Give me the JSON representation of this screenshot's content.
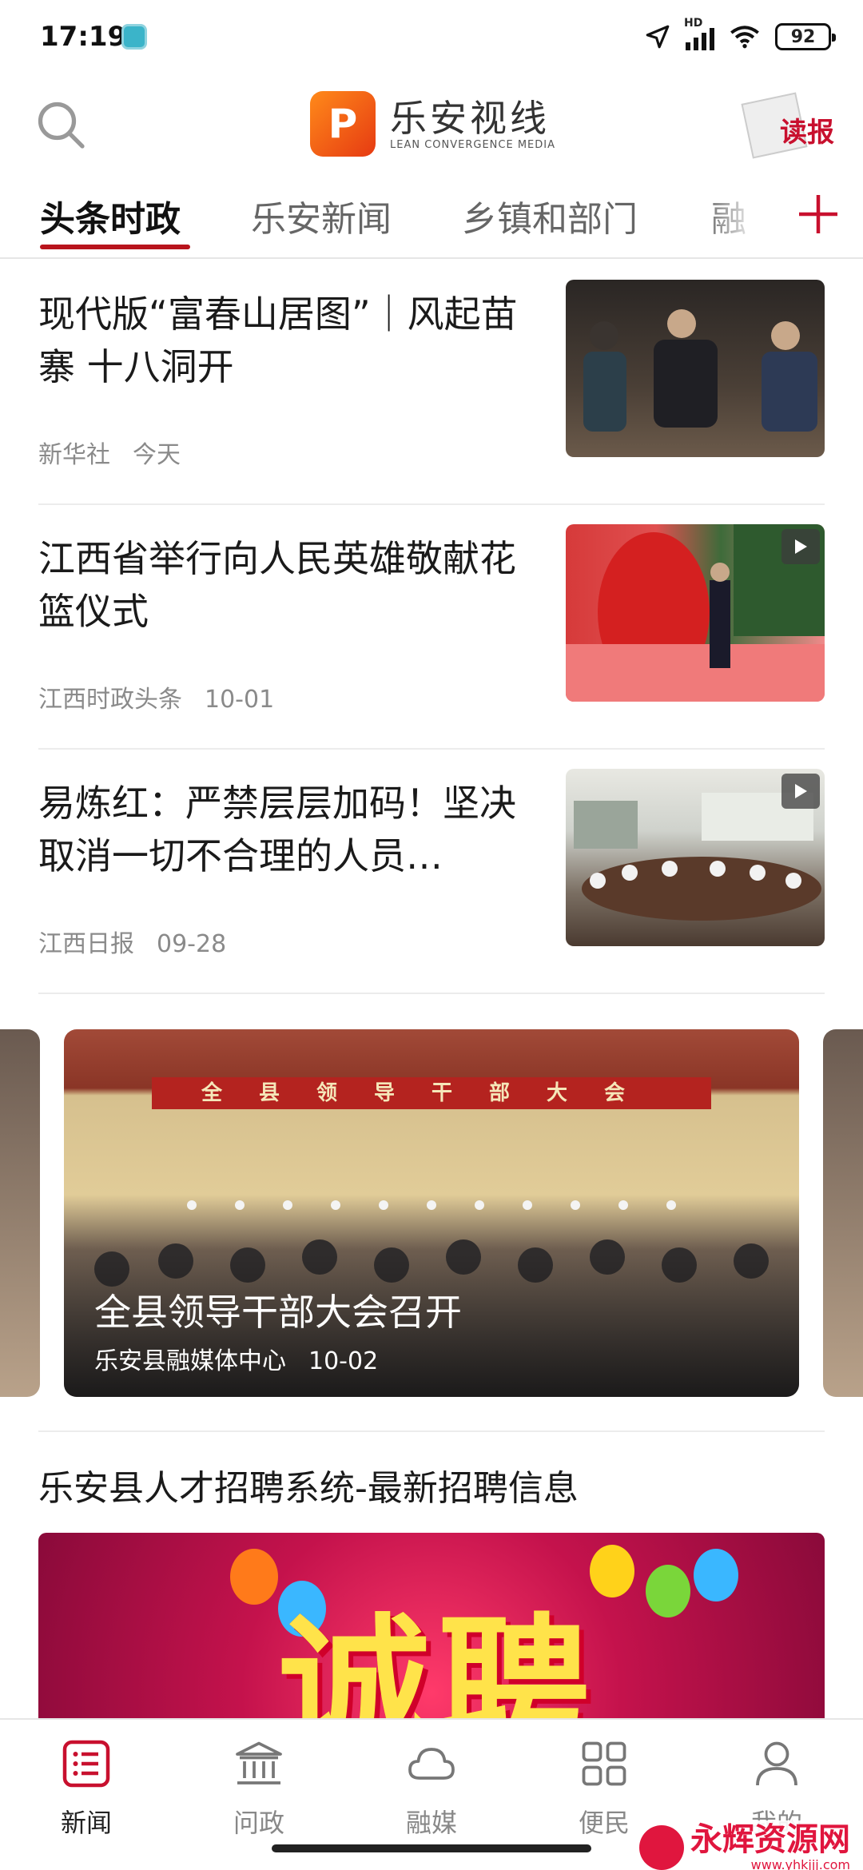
{
  "status_bar": {
    "time": "17:19",
    "network": "HD",
    "battery": "92"
  },
  "header": {
    "app_name": "乐安视线",
    "app_subtitle": "LEAN CONVERGENCE MEDIA",
    "logo_letter": "P",
    "read_paper_label": "读报"
  },
  "tabs": [
    {
      "label": "头条时政",
      "active": true
    },
    {
      "label": "乐安新闻",
      "active": false
    },
    {
      "label": "乡镇和部门",
      "active": false
    },
    {
      "label": "融",
      "active": false
    }
  ],
  "news": [
    {
      "title": "现代版“富春山居图”｜风起苗寨 十八洞开",
      "source": "新华社",
      "date": "今天",
      "has_video": false
    },
    {
      "title": "江西省举行向人民英雄敬献花篮仪式",
      "source": "江西时政头条",
      "date": "10-01",
      "has_video": true
    },
    {
      "title": "易炼红：严禁层层加码！坚决取消一切不合理的人员…",
      "source": "江西日报",
      "date": "09-28",
      "has_video": true
    }
  ],
  "carousel": {
    "banner": "全县领导干部大会",
    "title": "全县领导干部大会召开",
    "source": "乐安县融媒体中心",
    "date": "10-02"
  },
  "recruit": {
    "section_title": "乐安县人才招聘系统-最新招聘信息",
    "banner_text": "诚聘"
  },
  "bottom_nav": [
    {
      "label": "新闻",
      "icon": "news-list-icon",
      "active": true
    },
    {
      "label": "问政",
      "icon": "government-building-icon",
      "active": false
    },
    {
      "label": "融媒",
      "icon": "cloud-icon",
      "active": false
    },
    {
      "label": "便民",
      "icon": "grid-apps-icon",
      "active": false
    },
    {
      "label": "我的",
      "icon": "user-profile-icon",
      "active": false
    }
  ],
  "watermark": {
    "name": "永辉资源网",
    "url": "www.yhkjjj.com"
  },
  "colors": {
    "accent": "#b8141c",
    "tab_inactive": "#666666",
    "meta_text": "#8a8a8a"
  }
}
